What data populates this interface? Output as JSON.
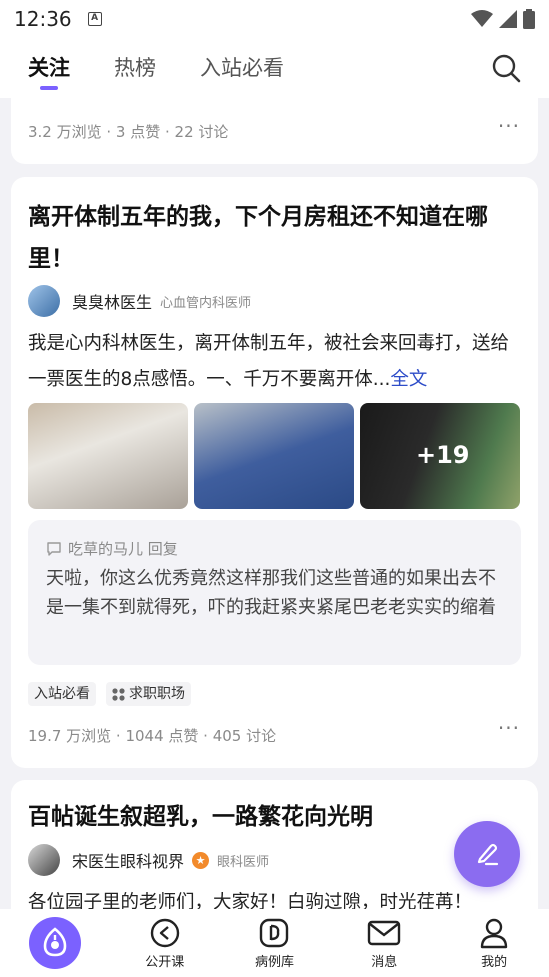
{
  "status": {
    "time": "12:36",
    "sim_label": "A"
  },
  "nav": {
    "tabs": [
      {
        "label": "关注"
      },
      {
        "label": "热榜"
      },
      {
        "label": "入站必看"
      }
    ]
  },
  "posts": [
    {
      "stats": "3.2 万浏览 · 3 点赞 · 22 讨论"
    },
    {
      "title": "离开体制五年的我，下个月房租还不知道在哪里！",
      "author": {
        "name": "臭臭林医生",
        "role": "心血管内科医师"
      },
      "excerpt": "我是心内科林医生，离开体制五年，被社会来回毒打，送给一票医生的8点感悟。一、千万不要离开体...",
      "read_more": "全文",
      "image_more_count": "+19",
      "reply": {
        "who": "吃草的马儿 回复",
        "text": "天啦，你这么优秀竟然这样那我们这些普通的如果出去不是一集不到就得死，吓的我赶紧夹紧尾巴老老实实的缩着"
      },
      "tags": [
        {
          "label": "入站必看"
        },
        {
          "label": "求职职场"
        }
      ],
      "stats": "19.7 万浏览 · 1044 点赞 · 405 讨论"
    },
    {
      "title": "百帖诞生叙超乳，一路繁花向光明",
      "author": {
        "name": "宋医生眼科视界",
        "role": "眼科医师"
      },
      "excerpt": "各位园子里的老师们，大家好！白驹过隙，时光荏苒！"
    }
  ],
  "bottom_nav": [
    {
      "label": ""
    },
    {
      "label": "公开课"
    },
    {
      "label": "病例库"
    },
    {
      "label": "消息"
    },
    {
      "label": "我的"
    }
  ],
  "colors": {
    "accent": "#7b61ff",
    "link": "#2d4cc8",
    "fab": "#8b6cf0"
  }
}
